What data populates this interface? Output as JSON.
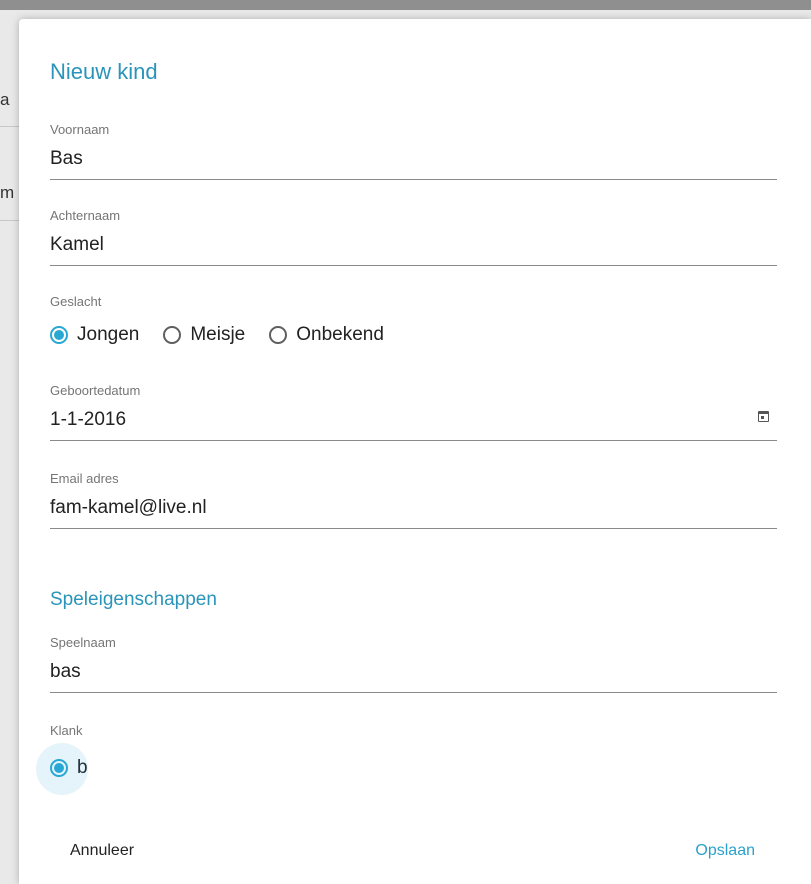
{
  "background": {
    "fragments": [
      "a",
      "m"
    ]
  },
  "dialog": {
    "title": "Nieuw kind",
    "fields": {
      "voornaam": {
        "label": "Voornaam",
        "value": "Bas"
      },
      "achternaam": {
        "label": "Achternaam",
        "value": "Kamel"
      },
      "geslacht": {
        "label": "Geslacht",
        "options": [
          "Jongen",
          "Meisje",
          "Onbekend"
        ],
        "selected": "Jongen"
      },
      "geboortedatum": {
        "label": "Geboortedatum",
        "value": "1-1-2016",
        "icon": "calendar-icon"
      },
      "email": {
        "label": "Email adres",
        "value": "fam-kamel@live.nl"
      }
    },
    "section_title": "Speleigenschappen",
    "game_fields": {
      "speelnaam": {
        "label": "Speelnaam",
        "value": "bas"
      },
      "klank": {
        "label": "Klank",
        "options": [
          "b"
        ],
        "selected": "b"
      }
    },
    "actions": {
      "cancel_label": "Annuleer",
      "save_label": "Opslaan"
    }
  },
  "colors": {
    "accent": "#29a8d4",
    "title": "#2a94ba"
  }
}
